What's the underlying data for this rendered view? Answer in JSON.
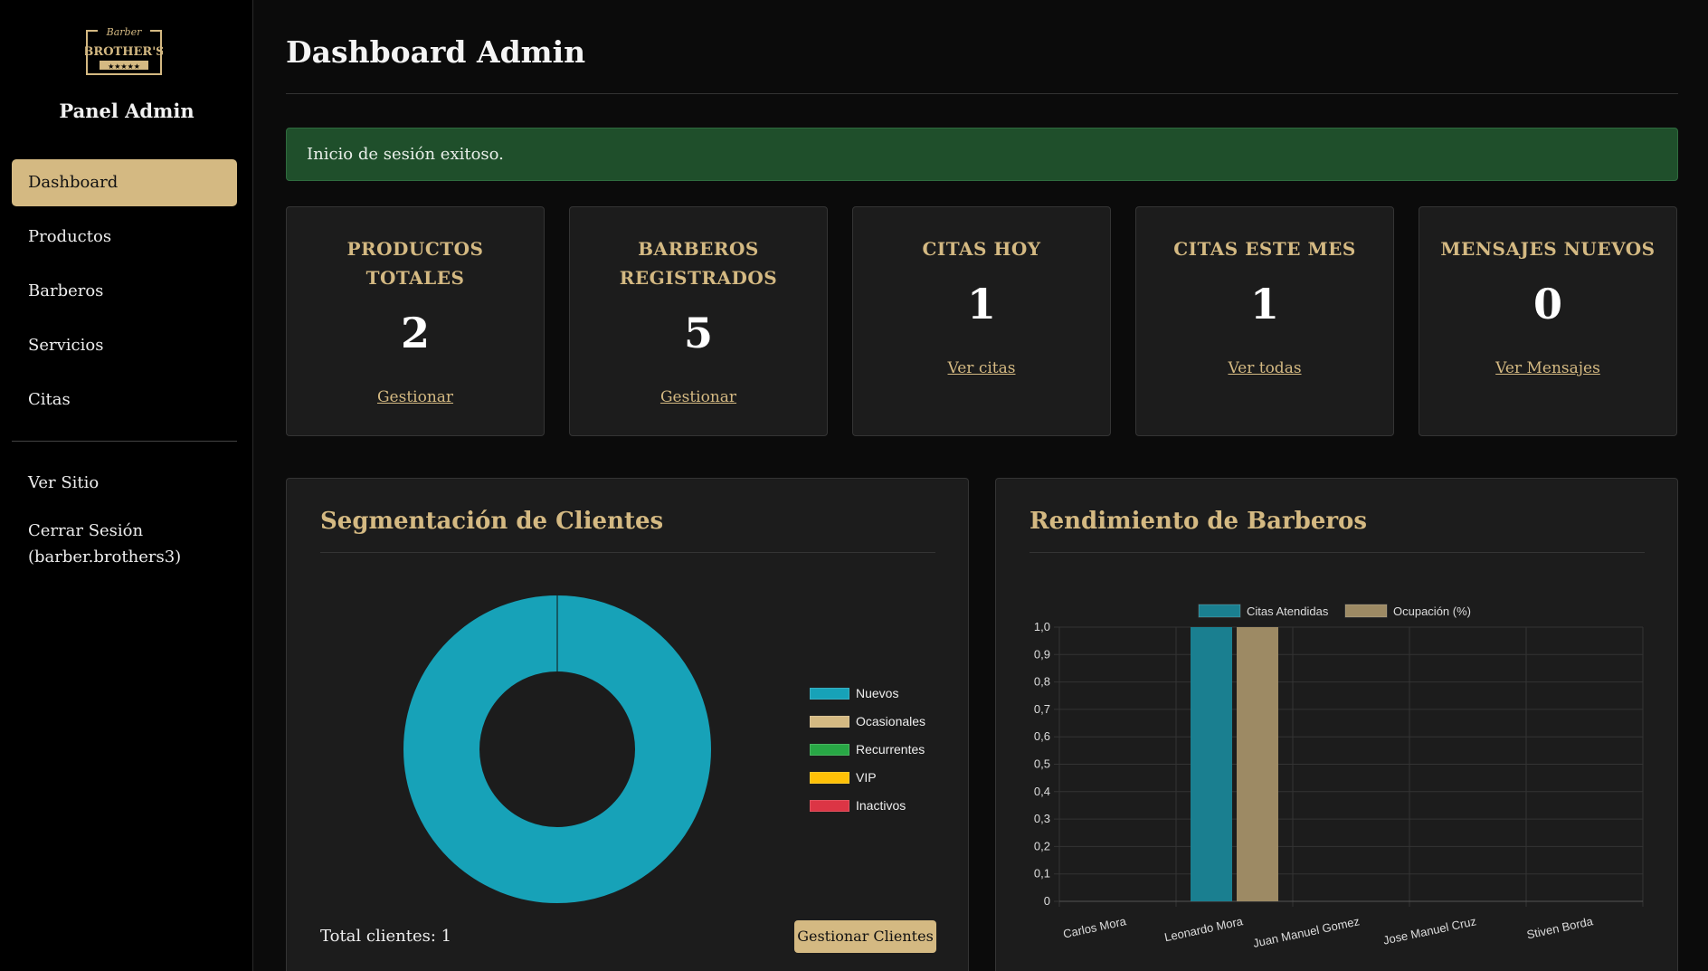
{
  "sidebar": {
    "logo": {
      "top_text": "Barber",
      "main_text": "BROTHER'S",
      "stars": "★★★★★"
    },
    "panel_title": "Panel Admin",
    "items": [
      {
        "label": "Dashboard",
        "active": true
      },
      {
        "label": "Productos"
      },
      {
        "label": "Barberos"
      },
      {
        "label": "Servicios"
      },
      {
        "label": "Citas"
      }
    ],
    "secondary": [
      {
        "label": "Ver Sitio"
      },
      {
        "label": "Cerrar Sesión (barber.brothers3)"
      }
    ]
  },
  "header": {
    "title": "Dashboard Admin"
  },
  "alert": {
    "text": "Inicio de sesión exitoso.",
    "color": "#1f4f2b"
  },
  "cards": [
    {
      "label": "PRODUCTOS TOTALES",
      "value": "2",
      "link": "Gestionar"
    },
    {
      "label": "BARBEROS REGISTRADOS",
      "value": "5",
      "link": "Gestionar"
    },
    {
      "label": "CITAS HOY",
      "value": "1",
      "link": "Ver citas"
    },
    {
      "label": "CITAS ESTE MES",
      "value": "1",
      "link": "Ver todas"
    },
    {
      "label": "MENSAJES NUEVOS",
      "value": "0",
      "link": "Ver Mensajes"
    }
  ],
  "segmentation": {
    "title": "Segmentación de Clientes",
    "total_label": "Total clientes: 1",
    "button": "Gestionar Clientes"
  },
  "performance": {
    "title": "Rendimiento de Barberos"
  },
  "colors": {
    "accent": "#d4b982",
    "teal": "#17a2b8",
    "green": "#28a745",
    "yellow": "#ffc107",
    "red": "#dc3545"
  },
  "chart_data": [
    {
      "type": "pie",
      "title": "",
      "categories": [
        "Nuevos",
        "Ocasionales",
        "Recurrentes",
        "VIP",
        "Inactivos"
      ],
      "values": [
        1,
        0,
        0,
        0,
        0
      ],
      "colors": [
        "#17a2b8",
        "#d4b982",
        "#28a745",
        "#ffc107",
        "#dc3545"
      ],
      "legend": "right"
    },
    {
      "type": "bar",
      "title": "",
      "categories": [
        "Carlos Mora",
        "Leonardo Mora",
        "Juan Manuel Gomez",
        "Jose Manuel Cruz",
        "Stiven Borda"
      ],
      "series": [
        {
          "name": "Citas Atendidas",
          "values": [
            0,
            1,
            0,
            0,
            0
          ],
          "color": "#1a7f90"
        },
        {
          "name": "Ocupación (%)",
          "values": [
            0,
            1,
            0,
            0,
            0
          ],
          "color": "#9d8a64"
        }
      ],
      "yticks": [
        "0",
        "0,1",
        "0,2",
        "0,3",
        "0,4",
        "0,5",
        "0,6",
        "0,7",
        "0,8",
        "0,9",
        "1,0"
      ],
      "ylim": [
        0,
        1
      ],
      "grid": true,
      "legend": "top"
    }
  ]
}
